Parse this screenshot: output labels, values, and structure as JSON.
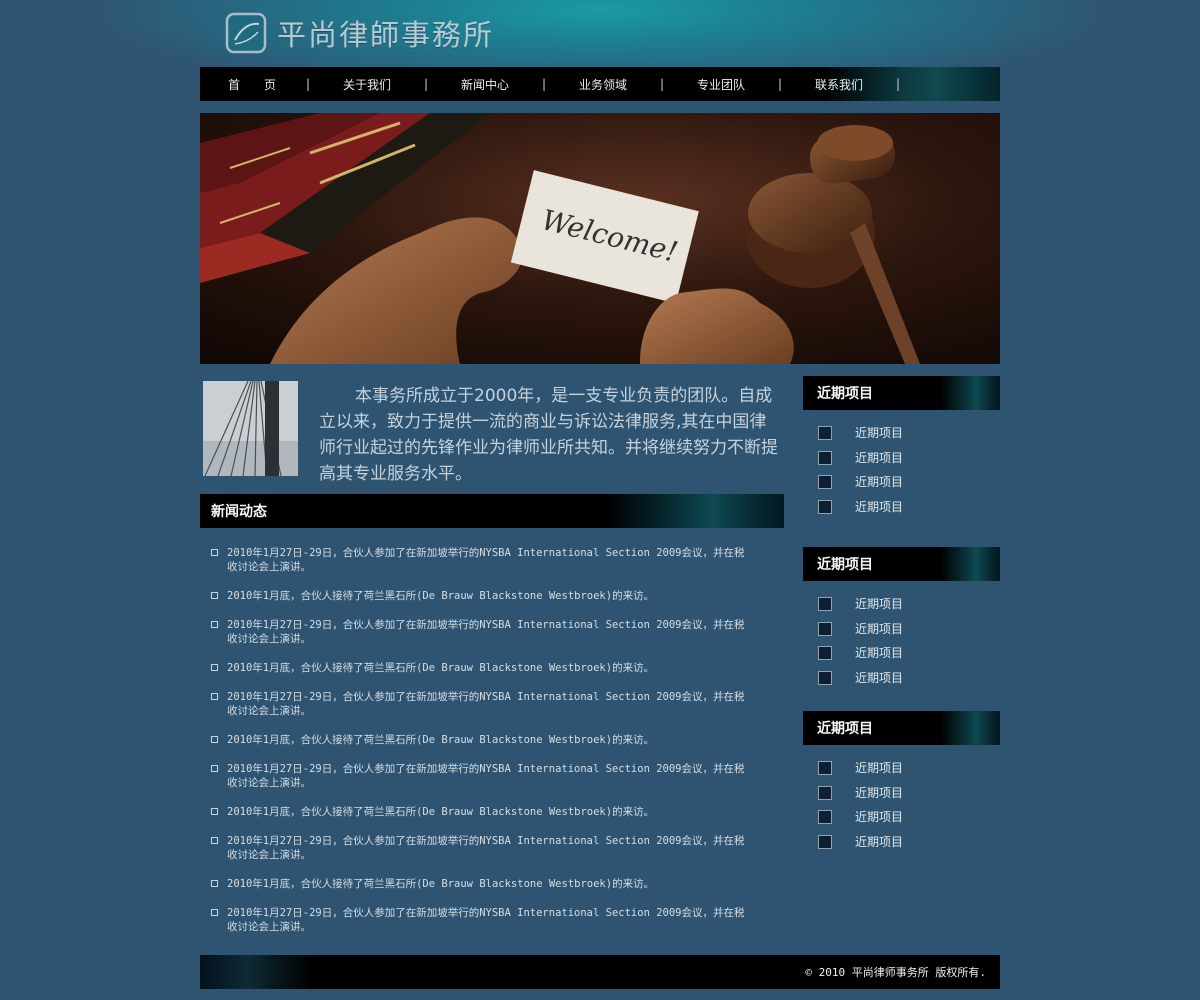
{
  "brand": {
    "name": "平尚律師事務所",
    "logo_icon": "law-firm-logo-icon"
  },
  "nav": [
    {
      "label": "首　　页"
    },
    {
      "label": "关于我们"
    },
    {
      "label": "新闻中心"
    },
    {
      "label": "业务领域"
    },
    {
      "label": "专业团队"
    },
    {
      "label": "联系我们"
    }
  ],
  "nav_separator": "|",
  "banner": {
    "card_text": "Welcome!"
  },
  "intro": {
    "text": "本事务所成立于2000年，是一支专业负责的团队。自成立以来，致力于提供一流的商业与诉讼法律服务,其在中国律师行业起过的先锋作业为律师业所共知。并将继续努力不断提高其专业服务水平。"
  },
  "news": {
    "title": "新闻动态",
    "items": [
      "2010年1月27日-29日，合伙人参加了在新加坡举行的NYSBA International Section  2009会议，并在税收讨论会上演讲。",
      "2010年1月底，合伙人接待了荷兰黑石所(De Brauw Blackstone Westbroek)的来访。",
      "2010年1月27日-29日，合伙人参加了在新加坡举行的NYSBA International Section  2009会议，并在税收讨论会上演讲。",
      "2010年1月底，合伙人接待了荷兰黑石所(De Brauw Blackstone Westbroek)的来访。",
      "2010年1月27日-29日，合伙人参加了在新加坡举行的NYSBA International Section  2009会议，并在税收讨论会上演讲。",
      "2010年1月底，合伙人接待了荷兰黑石所(De Brauw Blackstone Westbroek)的来访。",
      "2010年1月27日-29日，合伙人参加了在新加坡举行的NYSBA International Section  2009会议，并在税收讨论会上演讲。",
      "2010年1月底，合伙人接待了荷兰黑石所(De Brauw Blackstone Westbroek)的来访。",
      "2010年1月27日-29日，合伙人参加了在新加坡举行的NYSBA International Section  2009会议，并在税收讨论会上演讲。",
      "2010年1月底，合伙人接待了荷兰黑石所(De Brauw Blackstone Westbroek)的来访。",
      "2010年1月27日-29日，合伙人参加了在新加坡举行的NYSBA International Section  2009会议，并在税收讨论会上演讲。"
    ]
  },
  "sidebar": {
    "panels": [
      {
        "title": "近期项目",
        "items": [
          "近期项目",
          "近期项目",
          "近期项目",
          "近期项目"
        ]
      },
      {
        "title": "近期项目",
        "items": [
          "近期项目",
          "近期项目",
          "近期项目",
          "近期项目"
        ]
      },
      {
        "title": "近期项目",
        "items": [
          "近期项目",
          "近期项目",
          "近期项目",
          "近期项目"
        ]
      }
    ]
  },
  "footer": {
    "text": "© 2010 平尚律师事务所 版权所有."
  },
  "colors": {
    "page_bg": "#2f5471",
    "bar_bg": "#000000",
    "header_glow": "#1a9ba3",
    "text_light": "#c5d2dc"
  }
}
